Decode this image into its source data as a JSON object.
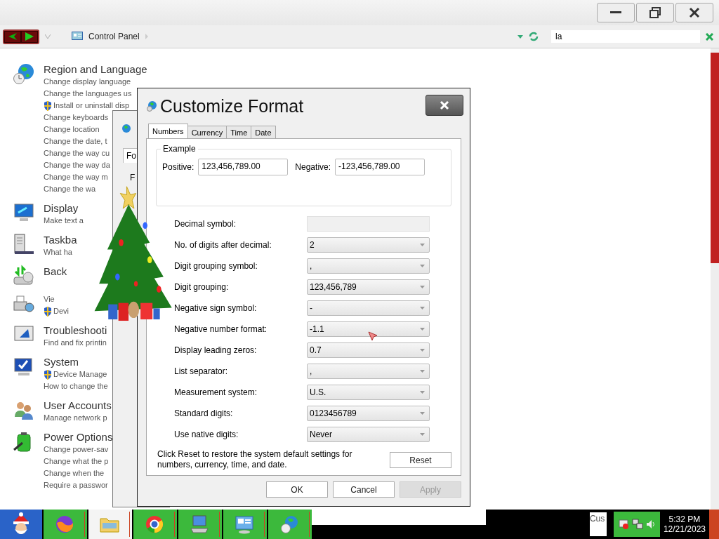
{
  "explorer": {
    "breadcrumb": "Control Panel",
    "search": {
      "value": "la"
    },
    "categories": [
      {
        "title": "Region and Language",
        "links": [
          {
            "text": "Change display language",
            "shield": false
          },
          {
            "text": "Change the languages us",
            "shield": false
          },
          {
            "text": "Install or uninstall disp",
            "shield": true
          },
          {
            "text": "Change keyboards",
            "shield": false
          },
          {
            "text": "Change location",
            "shield": false
          },
          {
            "text": "Change the date, t",
            "shield": false
          },
          {
            "text": "Change the way cu",
            "shield": false
          },
          {
            "text": "Change the way da",
            "shield": false
          },
          {
            "text": "Change the way m",
            "shield": false
          },
          {
            "text": "Change the wa",
            "shield": false
          }
        ]
      },
      {
        "title": "Display",
        "links": [
          {
            "text": "Make text a",
            "shield": false
          }
        ]
      },
      {
        "title": "Taskba",
        "links": [
          {
            "text": "What ha",
            "shield": false
          }
        ]
      },
      {
        "title": "Back"
      },
      {
        "links": [
          {
            "text": "Vie",
            "shield": false
          },
          {
            "text": "Devi",
            "shield": true
          }
        ]
      },
      {
        "title": "Troubleshooti",
        "links": [
          {
            "text": "Find and fix printin",
            "shield": false
          }
        ]
      },
      {
        "title": "System",
        "links": [
          {
            "text": "Device Manage",
            "shield": true
          },
          {
            "text": "How to change the",
            "shield": false
          }
        ]
      },
      {
        "title": "User Accounts",
        "links": [
          {
            "text": "Manage network p",
            "shield": false
          }
        ]
      },
      {
        "title": "Power Options",
        "links": [
          {
            "text": "Change power-sav",
            "shield": false
          },
          {
            "text": "Change what the p",
            "shield": false
          },
          {
            "text": "Change when the",
            "shield": false
          },
          {
            "text": "Require a passwor",
            "shield": false
          }
        ]
      }
    ]
  },
  "region_window": {
    "tab": "Fo",
    "label": "F"
  },
  "dialog": {
    "title": "Customize Format",
    "tabs": [
      {
        "label": "Numbers",
        "selected": true
      },
      {
        "label": "Currency",
        "selected": false
      },
      {
        "label": "Time",
        "selected": false
      },
      {
        "label": "Date",
        "selected": false
      }
    ],
    "example": {
      "title": "Example",
      "positive_label": "Positive:",
      "positive": "123,456,789.00",
      "negative_label": "Negative:",
      "negative": "-123,456,789.00"
    },
    "settings": [
      {
        "label": "Decimal symbol:",
        "kind": "blank"
      },
      {
        "label": "No. of digits after decimal:",
        "kind": "dropdown",
        "value": "2"
      },
      {
        "label": "Digit grouping symbol:",
        "kind": "dropdown",
        "value": ","
      },
      {
        "label": "Digit grouping:",
        "kind": "dropdown",
        "value": "123,456,789"
      },
      {
        "label": "Negative sign symbol:",
        "kind": "dropdown",
        "value": "-"
      },
      {
        "label": "Negative number format:",
        "kind": "dropdown",
        "value": "-1.1"
      },
      {
        "label": "Display leading zeros:",
        "kind": "dropdown",
        "value": "0.7"
      },
      {
        "label": "List separator:",
        "kind": "dropdown",
        "value": ","
      },
      {
        "label": "Measurement system:",
        "kind": "dropdown",
        "value": "U.S."
      },
      {
        "label": "Standard digits:",
        "kind": "dropdown",
        "value": "0123456789"
      },
      {
        "label": "Use native digits:",
        "kind": "dropdown",
        "value": "Never"
      }
    ],
    "reset_note": "Click Reset to restore the system default settings for numbers, currency, time, and date.",
    "reset": "Reset",
    "buttons": [
      {
        "label": "OK",
        "disabled": false
      },
      {
        "label": "Cancel",
        "disabled": false
      },
      {
        "label": "Apply",
        "disabled": true
      }
    ]
  },
  "taskbar": {
    "apps": [
      {
        "kind": "firefox",
        "selected": false
      },
      {
        "kind": "folder",
        "selected": true
      },
      {
        "kind": "chrome",
        "selected": false
      },
      {
        "kind": "computer",
        "selected": false
      },
      {
        "kind": "control-panel",
        "selected": false
      },
      {
        "kind": "globe",
        "selected": false
      }
    ],
    "preview": "Cus",
    "time": "5:32 PM",
    "date": "12/21/2023"
  }
}
